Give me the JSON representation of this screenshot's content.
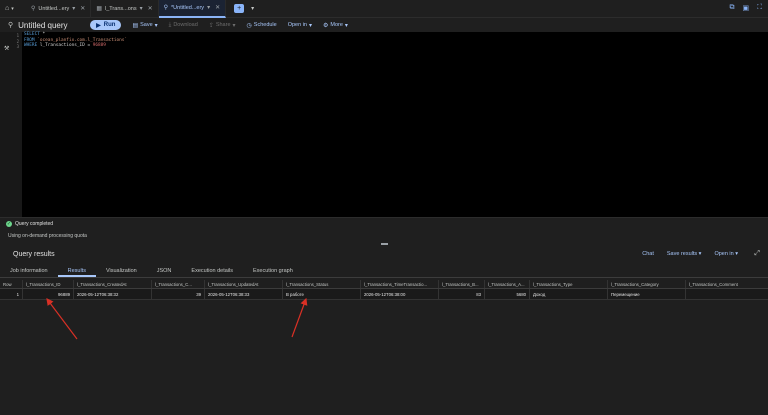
{
  "tabbar": {
    "tabs": [
      {
        "label": "Untitled...ery",
        "active": false
      },
      {
        "label": "l_Trans...ons",
        "active": false
      },
      {
        "label": "*Untitled...ery",
        "active": true
      }
    ]
  },
  "toolbar": {
    "title": "Untitled query",
    "run": "Run",
    "save": "Save",
    "download": "Download",
    "share": "Share",
    "schedule": "Schedule",
    "open_in": "Open in",
    "more": "More"
  },
  "editor": {
    "line_numbers": [
      "1",
      "2",
      "3"
    ],
    "line1_kw": "SELECT",
    "line1_rest": " *",
    "line2_kw": "FROM",
    "line2_str": " `ocean_planfix.com.l_Transactions`",
    "line3_kw": "WHERE",
    "line3_mid": " l_Transactions_ID = ",
    "line3_num": "96889"
  },
  "status": {
    "completed": "Query completed",
    "quota": "Using on-demand processing quota"
  },
  "results": {
    "title": "Query results",
    "chat": "Chat",
    "save_results": "Save results",
    "open_in": "Open in",
    "tabs": [
      "Job information",
      "Results",
      "Visualization",
      "JSON",
      "Execution details",
      "Execution graph"
    ],
    "columns": [
      "Row",
      "l_Transactions_ID",
      "l_Transactions_CreatedAt",
      "l_Transactions_C...",
      "l_Transactions_UpdatedAt",
      "l_Transactions_Status",
      "l_Transactions_TimeTransactio...",
      "l_Transactions_B...",
      "l_Transactions_A...",
      "l_Transactions_Type",
      "l_Transactions_Category",
      "l_Transactions_Comment"
    ],
    "row": [
      "1",
      "96889",
      "2026-05-12T06:38:32",
      "39",
      "2026-05-12T06:38:33",
      "В работе",
      "2026-05-12T06:38:00",
      "83",
      "5680",
      "Доход",
      "Перемещение",
      ""
    ]
  },
  "colors": {
    "accent": "#a8c7fa",
    "run_button": "#a8c7fa",
    "success": "#6dd58c",
    "arrow": "#d93025"
  }
}
